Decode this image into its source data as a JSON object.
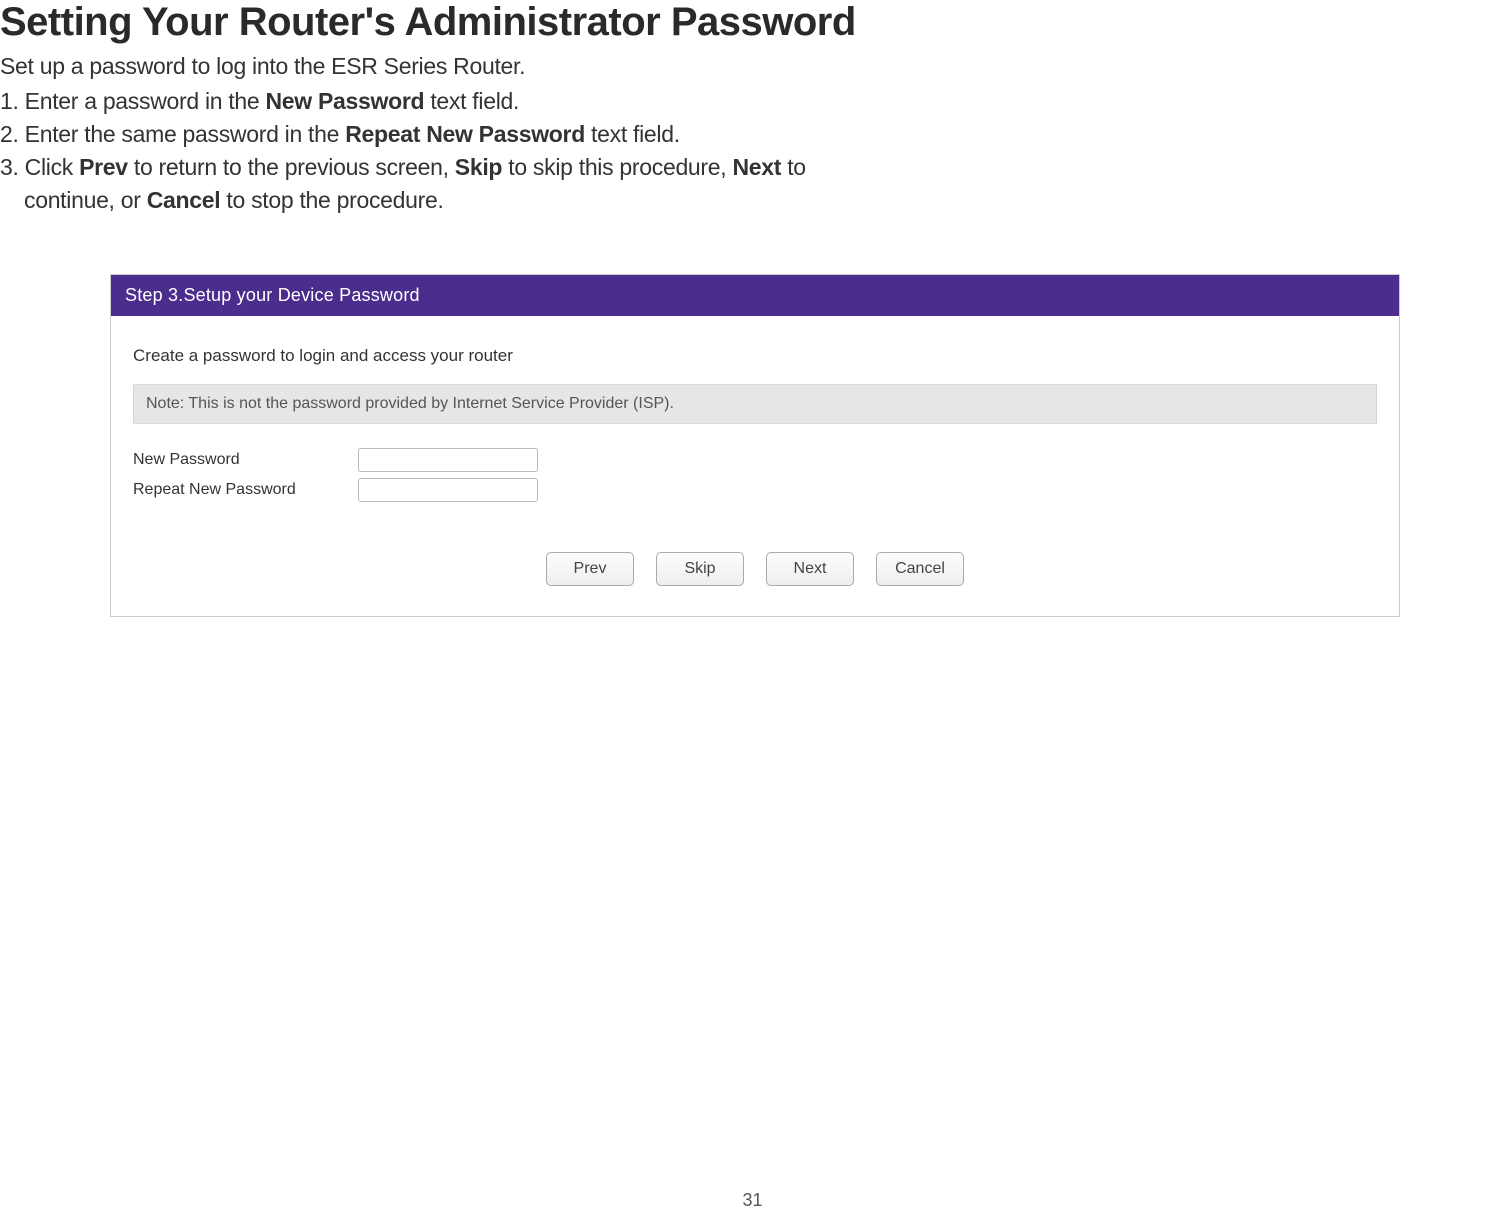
{
  "heading": "Setting Your Router's Administrator Password",
  "subheading": "Set up a password to log into the ESR Series Router.",
  "steps": {
    "s1_pre": "1. Enter a password in the ",
    "s1_bold": "New Password",
    "s1_post": " text field.",
    "s2_pre": "2. Enter the same password in the ",
    "s2_bold": "Repeat New Password",
    "s2_post": " text field.",
    "s3_pre": "3. Click ",
    "s3_b1": "Prev",
    "s3_mid1": " to return to the previous screen, ",
    "s3_b2": "Skip",
    "s3_mid2": " to skip this procedure, ",
    "s3_b3": "Next",
    "s3_mid3": " to",
    "s3_cont_pre": "continue, or ",
    "s3_b4": "Cancel",
    "s3_cont_post": " to stop the procedure."
  },
  "wizard": {
    "header": "Step 3.Setup your Device Password",
    "instruction": "Create a password to login and access your router",
    "note": "Note: This is not the password provided by Internet Service Provider (ISP).",
    "label_new": "New Password",
    "label_repeat": "Repeat New Password",
    "buttons": {
      "prev": "Prev",
      "skip": "Skip",
      "next": "Next",
      "cancel": "Cancel"
    }
  },
  "page_number": "31"
}
